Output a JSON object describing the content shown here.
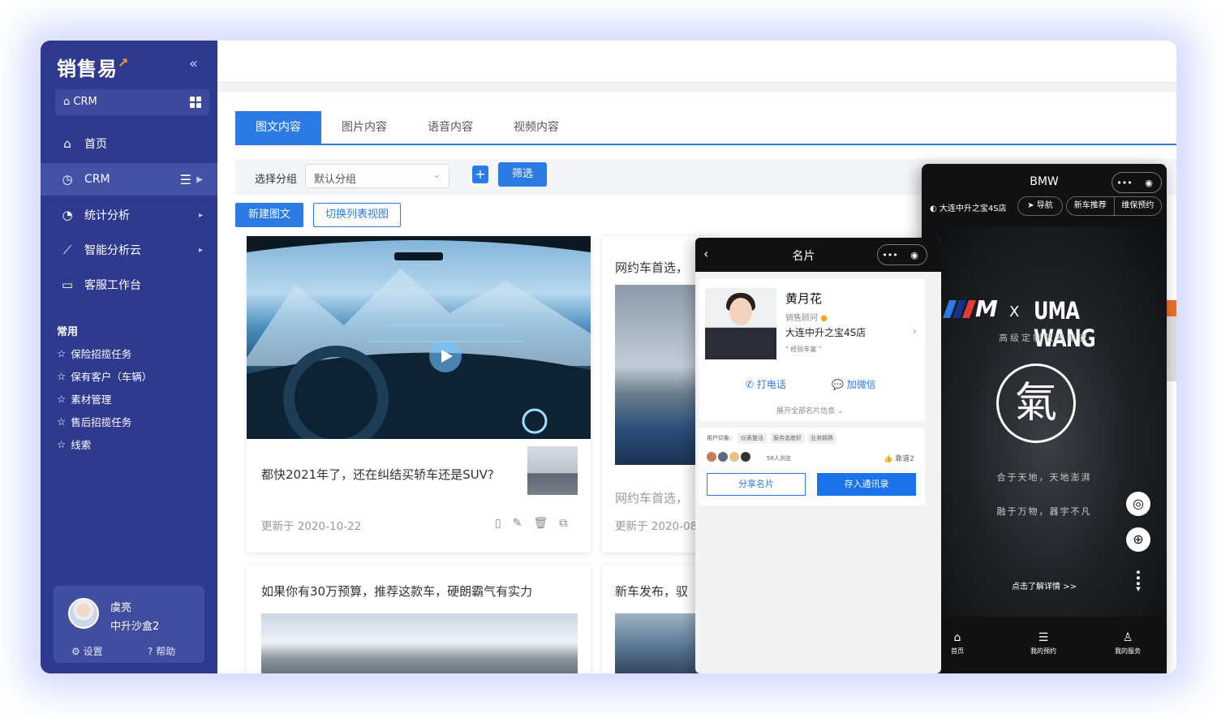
{
  "sidebar": {
    "logo": "销售易",
    "crm_switch": "CRM",
    "nav": [
      {
        "label": "首页",
        "icon": "home-icon"
      },
      {
        "label": "CRM",
        "icon": "pie-icon"
      },
      {
        "label": "统计分析",
        "icon": "chart-pie-icon"
      },
      {
        "label": "智能分析云",
        "icon": "line-chart-icon"
      },
      {
        "label": "客服工作台",
        "icon": "monitor-icon"
      }
    ],
    "section_title": "常用",
    "favorites": [
      "保险招揽任务",
      "保有客户（车辆）",
      "素材管理",
      "售后招揽任务",
      "线索"
    ],
    "user": {
      "name": "虞亮",
      "org": "中升沙盒2",
      "settings": "设置",
      "help": "帮助"
    }
  },
  "main": {
    "tabs": [
      "图文内容",
      "图片内容",
      "语音内容",
      "视频内容"
    ],
    "filter_label": "选择分组",
    "group_select": "默认分组",
    "plus": "+",
    "filter_btn": "筛选",
    "new_btn": "新建图文",
    "switch_btn": "切换列表视图",
    "cards": [
      {
        "title": "都快2021年了，还在纠结买轿车还是SUV?",
        "date": "更新于 2020-10-22"
      },
      {
        "title": "网约车首选，",
        "title2": "网约车首选，",
        "date": "更新于 2020-08"
      },
      {
        "title": "如果你有30万预算，推荐这款车，硬朗霸气有实力"
      },
      {
        "title": "新车发布，驭"
      }
    ]
  },
  "card_phone": {
    "title": "名片",
    "name": "黄月花",
    "role": "销售顾问",
    "shop": "大连中升之宝4S店",
    "tag": "\" 经验丰富 \"",
    "call": "打电话",
    "wechat": "加微信",
    "expand": "展开全部名片信息",
    "impression_label": "用户印象:",
    "impressions": [
      "仪表整洁",
      "服务态度好",
      "业务娴熟"
    ],
    "views": "58人浏览",
    "likes": "靠谱2",
    "share": "分享名片",
    "save": "存入通讯录"
  },
  "bmw_phone": {
    "title": "BMW",
    "shop": "大连中升之宝4S店",
    "nav_btn": "导航",
    "new_car": "新车推荐",
    "service": "维保预约",
    "brand_m": "M",
    "x": "X",
    "uma": "UMA WANG",
    "subtitle": "高级定制艺术车衣",
    "seal": "氣",
    "poem1": "合于天地，天地澎湃",
    "poem2": "融于万物，器宇不凡",
    "more": "点击了解详情 >>",
    "tabs": [
      "首页",
      "我的预约",
      "我的服务"
    ]
  }
}
